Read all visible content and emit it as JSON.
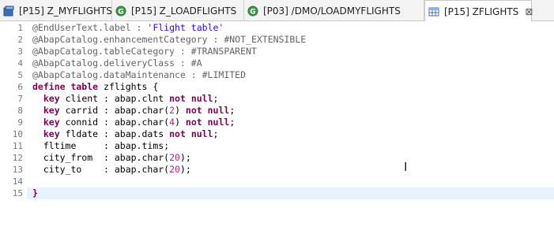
{
  "tabs": [
    {
      "label": "[P15] Z_MYFLIGHTS",
      "icon": "abap-class-icon"
    },
    {
      "label": "[P15] Z_LOADFLIGHTS",
      "icon": "abap-program-icon"
    },
    {
      "label": "[P03] /DMO/LOADMYFLIGHTS",
      "icon": "abap-program-icon"
    },
    {
      "label": "[P15] ZFLIGHTS",
      "icon": "table-icon",
      "close": "⊠"
    }
  ],
  "active_tab": 3,
  "colors": {
    "annotation": "#646464",
    "string": "#2a00ff",
    "keyword": "#7f0055",
    "number": "#b0286f",
    "current_line": "#e8f2fe"
  },
  "editor": {
    "line_numbers": [
      "1",
      "2",
      "3",
      "4",
      "5",
      "6",
      "7",
      "8",
      "9",
      "10",
      "11",
      "12",
      "13",
      "14",
      "15"
    ],
    "current_line": 15,
    "lines": [
      [
        {
          "t": "@EndUserText.label : ",
          "c": "ann"
        },
        {
          "t": "'Flight table'",
          "c": "str"
        }
      ],
      [
        {
          "t": "@AbapCatalog.enhancementCategory : #NOT_EXTENSIBLE",
          "c": "ann"
        }
      ],
      [
        {
          "t": "@AbapCatalog.tableCategory : #TRANSPARENT",
          "c": "ann"
        }
      ],
      [
        {
          "t": "@AbapCatalog.deliveryClass : #A",
          "c": "ann"
        }
      ],
      [
        {
          "t": "@AbapCatalog.dataMaintenance : #LIMITED",
          "c": "ann"
        }
      ],
      [
        {
          "t": "define table",
          "c": "kw"
        },
        {
          "t": " zflights {",
          "c": "id"
        }
      ],
      [
        {
          "t": "  ",
          "c": "id"
        },
        {
          "t": "key",
          "c": "kw"
        },
        {
          "t": " client : abap.clnt ",
          "c": "id"
        },
        {
          "t": "not null",
          "c": "kw"
        },
        {
          "t": ";",
          "c": "id"
        }
      ],
      [
        {
          "t": "  ",
          "c": "id"
        },
        {
          "t": "key",
          "c": "kw"
        },
        {
          "t": " carrid : abap.char(",
          "c": "id"
        },
        {
          "t": "2",
          "c": "num"
        },
        {
          "t": ") ",
          "c": "id"
        },
        {
          "t": "not null",
          "c": "kw"
        },
        {
          "t": ";",
          "c": "id"
        }
      ],
      [
        {
          "t": "  ",
          "c": "id"
        },
        {
          "t": "key",
          "c": "kw"
        },
        {
          "t": " connid : abap.char(",
          "c": "id"
        },
        {
          "t": "4",
          "c": "num"
        },
        {
          "t": ") ",
          "c": "id"
        },
        {
          "t": "not null",
          "c": "kw"
        },
        {
          "t": ";",
          "c": "id"
        }
      ],
      [
        {
          "t": "  ",
          "c": "id"
        },
        {
          "t": "key",
          "c": "kw"
        },
        {
          "t": " fldate : abap.dats ",
          "c": "id"
        },
        {
          "t": "not null",
          "c": "kw"
        },
        {
          "t": ";",
          "c": "id"
        }
      ],
      [
        {
          "t": "  fltime     : abap.tims;",
          "c": "id"
        }
      ],
      [
        {
          "t": "  city_from  : abap.char(",
          "c": "id"
        },
        {
          "t": "20",
          "c": "num"
        },
        {
          "t": ");",
          "c": "id"
        }
      ],
      [
        {
          "t": "  city_to    : abap.char(",
          "c": "id"
        },
        {
          "t": "20",
          "c": "num"
        },
        {
          "t": ");",
          "c": "id"
        }
      ],
      [
        {
          "t": "",
          "c": "id"
        }
      ],
      [
        {
          "t": "}",
          "c": "kw"
        }
      ]
    ]
  }
}
